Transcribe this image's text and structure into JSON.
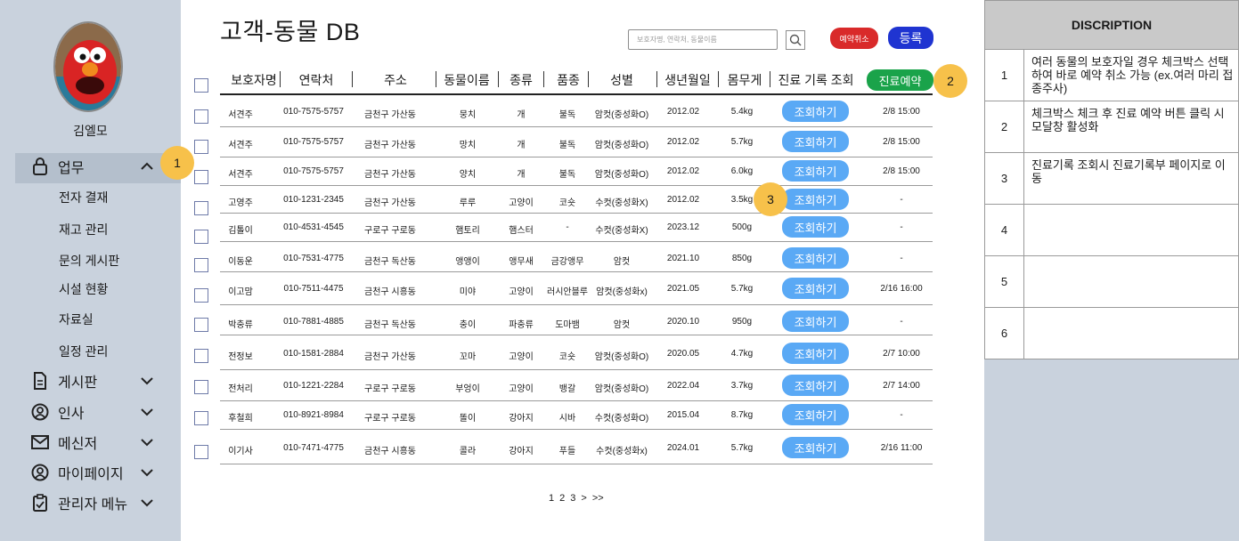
{
  "page_title": "고객-동물 DB",
  "user_name": "김엘모",
  "sidebar": {
    "work_label": "업무",
    "sub_items": [
      "전자 결재",
      "재고 관리",
      "문의 게시판",
      "시설 현황",
      "자료실",
      "일정 관리"
    ],
    "items": [
      "게시판",
      "인사",
      "메신저",
      "마이페이지",
      "관리자 메뉴"
    ]
  },
  "search": {
    "placeholder": "보호자명, 연락처, 동물이름"
  },
  "buttons": {
    "cancel": "예약취소",
    "register": "등록",
    "book": "진료예약",
    "view": "조회하기"
  },
  "table": {
    "headers": [
      "보호자명",
      "연락처",
      "주소",
      "동물이름",
      "종류",
      "품종",
      "성별",
      "생년월일",
      "몸무게",
      "진료 기록 조회"
    ],
    "rows": [
      [
        "서견주",
        "010-7575-5757",
        "금천구 가산동",
        "뭉치",
        "개",
        "불독",
        "암컷(중성화O)",
        "2012.02",
        "5.4kg",
        "2/8  15:00"
      ],
      [
        "서견주",
        "010-7575-5757",
        "금천구 가산동",
        "망치",
        "개",
        "불독",
        "암컷(중성화O)",
        "2012.02",
        "5.7kg",
        "2/8  15:00"
      ],
      [
        "서견주",
        "010-7575-5757",
        "금천구 가산동",
        "양치",
        "개",
        "불독",
        "암컷(중성화O)",
        "2012.02",
        "6.0kg",
        "2/8  15:00"
      ],
      [
        "고영주",
        "010-1231-2345",
        "금천구 가산동",
        "루루",
        "고양이",
        "코숏",
        "수컷(중성화X)",
        "2012.02",
        "3.5kg",
        "-"
      ],
      [
        "김톨이",
        "010-4531-4545",
        "구로구 구로동",
        "햄토리",
        "햄스터",
        "-",
        "수컷(중성화X)",
        "2023.12",
        "500g",
        "-"
      ],
      [
        "이동운",
        "010-7531-4775",
        "금천구 독산동",
        "앵앵이",
        "앵무새",
        "금강앵무",
        "암컷",
        "2021.10",
        "850g",
        "-"
      ],
      [
        "이고맘",
        "010-7511-4475",
        "금천구 시흥동",
        "미야",
        "고양이",
        "러시안블루",
        "암컷(중성화x)",
        "2021.05",
        "5.7kg",
        "2/16  16:00"
      ],
      [
        "박충류",
        "010-7881-4885",
        "금천구 독산동",
        "충이",
        "파충류",
        "도마뱀",
        "암컷",
        "2020.10",
        "950g",
        "-"
      ],
      [
        "전정보",
        "010-1581-2884",
        "금천구 가산동",
        "꼬마",
        "고양이",
        "코숏",
        "암컷(중성화O)",
        "2020.05",
        "4.7kg",
        "2/7  10:00"
      ],
      [
        "전처리",
        "010-1221-2284",
        "구로구 구로동",
        "부엉이",
        "고양이",
        "뱅갈",
        "암컷(중성화O)",
        "2022.04",
        "3.7kg",
        "2/7  14:00"
      ],
      [
        "후철희",
        "010-8921-8984",
        "구로구 구로동",
        "똘이",
        "강아지",
        "시바",
        "수컷(중성화O)",
        "2015.04",
        "8.7kg",
        "-"
      ],
      [
        "이기사",
        "010-7471-4775",
        "금천구 시흥동",
        "콜라",
        "강아지",
        "푸들",
        "수컷(중성화x)",
        "2024.01",
        "5.7kg",
        "2/16  11:00"
      ]
    ]
  },
  "pagination": [
    "1",
    "2",
    "3",
    ">",
    ">>"
  ],
  "badges": [
    "1",
    "2",
    "3"
  ],
  "description": {
    "title": "DISCRIPTION",
    "rows": [
      {
        "num": "1",
        "text": "여러 동물의 보호자일 경우 체크박스 선택하여 바로 예약  취소 가능 (ex.여러 마리 접종주사)"
      },
      {
        "num": "2",
        "text": "체크박스 체크 후 진료 예약 버튼 클릭 시 모달창 활성화"
      },
      {
        "num": "3",
        "text": "진료기록 조회시 진료기록부 페이지로 이동"
      },
      {
        "num": "4",
        "text": ""
      },
      {
        "num": "5",
        "text": ""
      },
      {
        "num": "6",
        "text": ""
      }
    ]
  }
}
